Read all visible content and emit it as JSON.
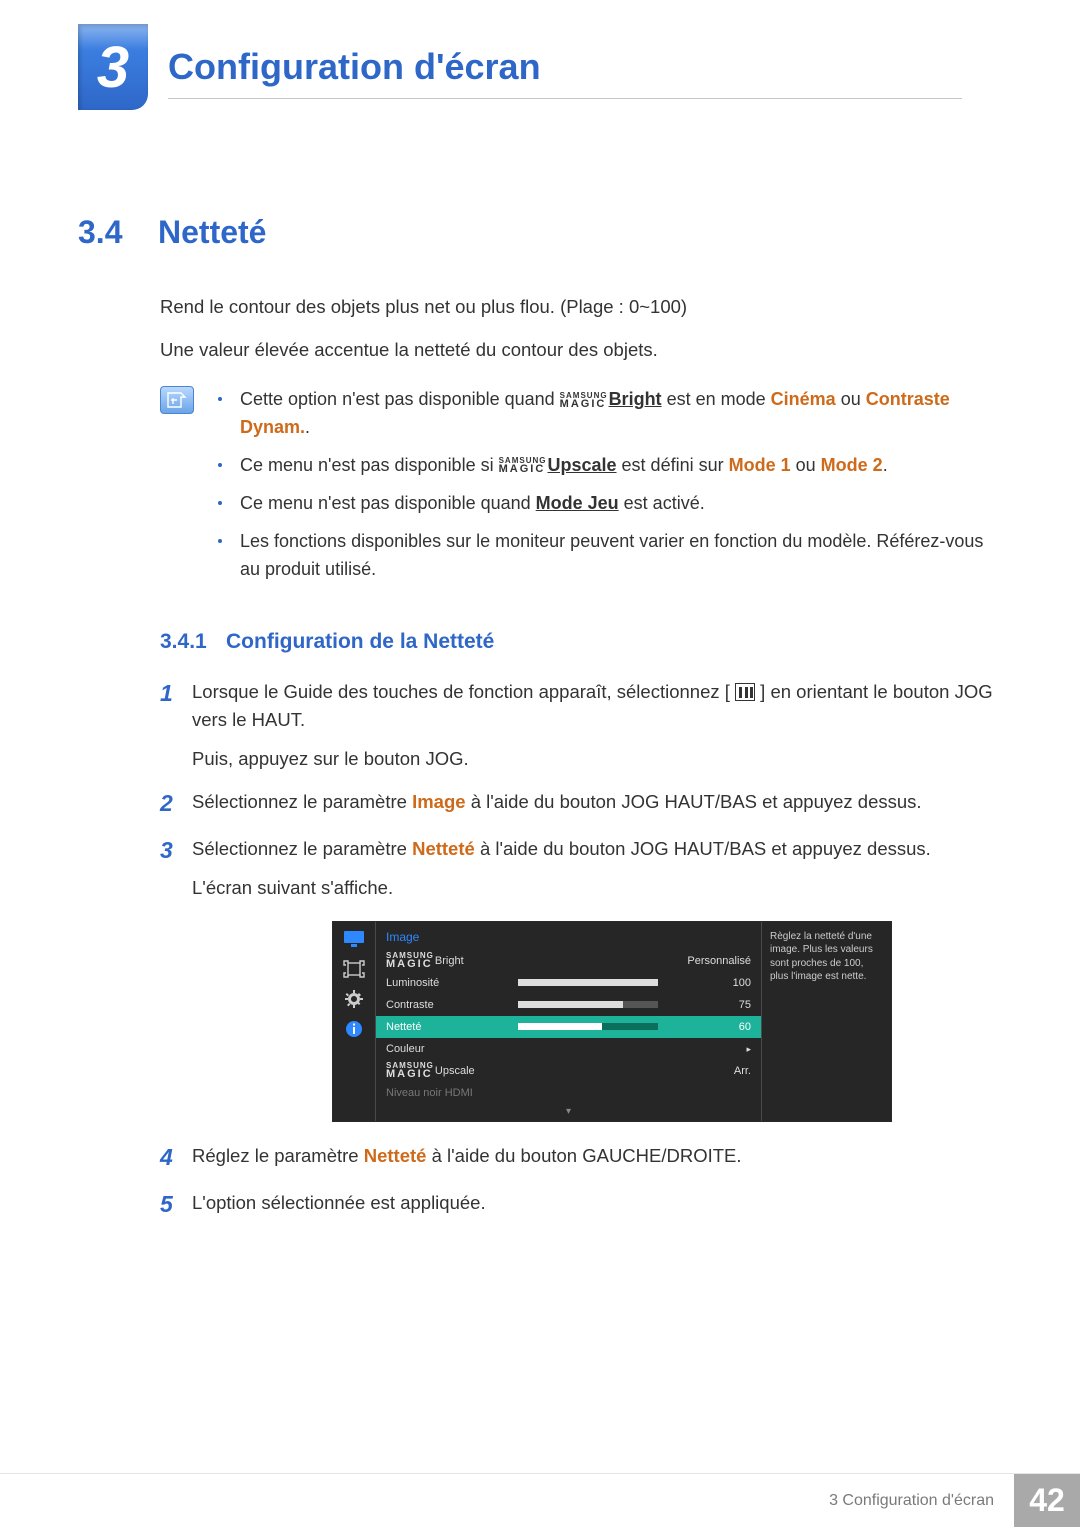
{
  "chapter": {
    "number": "3",
    "title": "Configuration d'écran"
  },
  "section": {
    "number": "3.4",
    "title": "Netteté"
  },
  "intro": {
    "p1": "Rend le contour des objets plus net ou plus flou. (Plage : 0~100)",
    "p2": "Une valeur élevée accentue la netteté du contour des objets."
  },
  "notes": {
    "n1a": "Cette option n'est pas disponible quand ",
    "n1_bright": "Bright",
    "n1b": " est en mode ",
    "n1_cinema": "Cinéma",
    "n1c": " ou ",
    "n1_dynam": "Contraste Dynam.",
    "n1d": ".",
    "n2a": "Ce menu n'est pas disponible si ",
    "n2_upscale": "Upscale",
    "n2b": " est défini sur ",
    "n2_m1": "Mode 1",
    "n2c": " ou ",
    "n2_m2": "Mode 2",
    "n2d": ".",
    "n3a": "Ce menu n'est pas disponible quand ",
    "n3_game": "Mode Jeu",
    "n3b": " est activé.",
    "n4": "Les fonctions disponibles sur le moniteur peuvent varier en fonction du modèle. Référez-vous au produit utilisé."
  },
  "magic": {
    "top": "SAMSUNG",
    "bottom": "MAGIC"
  },
  "subsection": {
    "number": "3.4.1",
    "title": "Configuration de la Netteté"
  },
  "steps": {
    "s1a": "Lorsque le Guide des touches de fonction apparaît, sélectionnez [",
    "s1b": "] en orientant le bouton JOG vers le HAUT.",
    "s1c": "Puis, appuyez sur le bouton JOG.",
    "s2a": "Sélectionnez le paramètre ",
    "s2_image": "Image",
    "s2b": " à l'aide du bouton JOG HAUT/BAS et appuyez dessus.",
    "s3a": "Sélectionnez le paramètre ",
    "s3_net": "Netteté",
    "s3b": " à l'aide du bouton JOG HAUT/BAS et appuyez dessus.",
    "s3c": "L'écran suivant s'affiche.",
    "s4a": "Réglez le paramètre ",
    "s4_net": "Netteté",
    "s4b": " à l'aide du bouton GAUCHE/DROITE.",
    "s5": "L'option sélectionnée est appliquée."
  },
  "osd": {
    "head": "Image",
    "desc": "Règlez la netteté d'une image. Plus les valeurs sont proches de 100, plus l'image est nette.",
    "rows": {
      "bright": {
        "label": "Bright",
        "value": "Personnalisé"
      },
      "lum": {
        "label": "Luminosité",
        "value": "100",
        "pct": 100
      },
      "contr": {
        "label": "Contraste",
        "value": "75",
        "pct": 75
      },
      "net": {
        "label": "Netteté",
        "value": "60",
        "pct": 60
      },
      "couleur": {
        "label": "Couleur"
      },
      "upscale": {
        "label": "Upscale",
        "value": "Arr."
      },
      "hdmi": {
        "label": "Niveau noir HDMI"
      }
    },
    "footer_arrow": "▾"
  },
  "footer": {
    "path": "3  Configuration d'écran",
    "page": "42"
  }
}
